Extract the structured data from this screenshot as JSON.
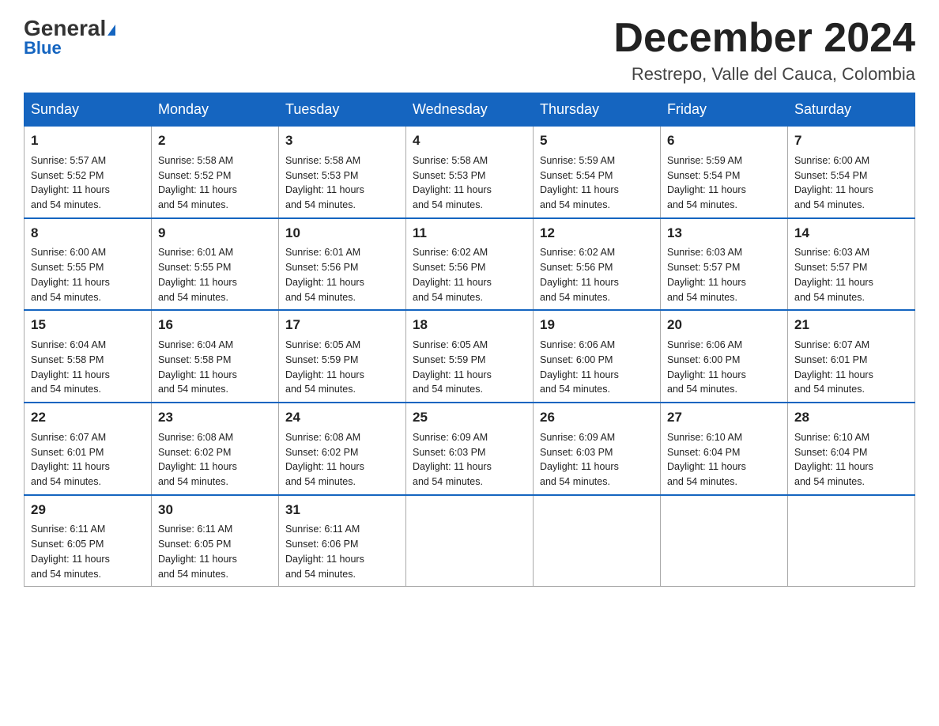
{
  "logo": {
    "line1": "General",
    "triangle": true,
    "line2": "Blue"
  },
  "header": {
    "month": "December 2024",
    "location": "Restrepo, Valle del Cauca, Colombia"
  },
  "days_of_week": [
    "Sunday",
    "Monday",
    "Tuesday",
    "Wednesday",
    "Thursday",
    "Friday",
    "Saturday"
  ],
  "weeks": [
    [
      {
        "day": "1",
        "sunrise": "5:57 AM",
        "sunset": "5:52 PM",
        "daylight": "11 hours and 54 minutes."
      },
      {
        "day": "2",
        "sunrise": "5:58 AM",
        "sunset": "5:52 PM",
        "daylight": "11 hours and 54 minutes."
      },
      {
        "day": "3",
        "sunrise": "5:58 AM",
        "sunset": "5:53 PM",
        "daylight": "11 hours and 54 minutes."
      },
      {
        "day": "4",
        "sunrise": "5:58 AM",
        "sunset": "5:53 PM",
        "daylight": "11 hours and 54 minutes."
      },
      {
        "day": "5",
        "sunrise": "5:59 AM",
        "sunset": "5:54 PM",
        "daylight": "11 hours and 54 minutes."
      },
      {
        "day": "6",
        "sunrise": "5:59 AM",
        "sunset": "5:54 PM",
        "daylight": "11 hours and 54 minutes."
      },
      {
        "day": "7",
        "sunrise": "6:00 AM",
        "sunset": "5:54 PM",
        "daylight": "11 hours and 54 minutes."
      }
    ],
    [
      {
        "day": "8",
        "sunrise": "6:00 AM",
        "sunset": "5:55 PM",
        "daylight": "11 hours and 54 minutes."
      },
      {
        "day": "9",
        "sunrise": "6:01 AM",
        "sunset": "5:55 PM",
        "daylight": "11 hours and 54 minutes."
      },
      {
        "day": "10",
        "sunrise": "6:01 AM",
        "sunset": "5:56 PM",
        "daylight": "11 hours and 54 minutes."
      },
      {
        "day": "11",
        "sunrise": "6:02 AM",
        "sunset": "5:56 PM",
        "daylight": "11 hours and 54 minutes."
      },
      {
        "day": "12",
        "sunrise": "6:02 AM",
        "sunset": "5:56 PM",
        "daylight": "11 hours and 54 minutes."
      },
      {
        "day": "13",
        "sunrise": "6:03 AM",
        "sunset": "5:57 PM",
        "daylight": "11 hours and 54 minutes."
      },
      {
        "day": "14",
        "sunrise": "6:03 AM",
        "sunset": "5:57 PM",
        "daylight": "11 hours and 54 minutes."
      }
    ],
    [
      {
        "day": "15",
        "sunrise": "6:04 AM",
        "sunset": "5:58 PM",
        "daylight": "11 hours and 54 minutes."
      },
      {
        "day": "16",
        "sunrise": "6:04 AM",
        "sunset": "5:58 PM",
        "daylight": "11 hours and 54 minutes."
      },
      {
        "day": "17",
        "sunrise": "6:05 AM",
        "sunset": "5:59 PM",
        "daylight": "11 hours and 54 minutes."
      },
      {
        "day": "18",
        "sunrise": "6:05 AM",
        "sunset": "5:59 PM",
        "daylight": "11 hours and 54 minutes."
      },
      {
        "day": "19",
        "sunrise": "6:06 AM",
        "sunset": "6:00 PM",
        "daylight": "11 hours and 54 minutes."
      },
      {
        "day": "20",
        "sunrise": "6:06 AM",
        "sunset": "6:00 PM",
        "daylight": "11 hours and 54 minutes."
      },
      {
        "day": "21",
        "sunrise": "6:07 AM",
        "sunset": "6:01 PM",
        "daylight": "11 hours and 54 minutes."
      }
    ],
    [
      {
        "day": "22",
        "sunrise": "6:07 AM",
        "sunset": "6:01 PM",
        "daylight": "11 hours and 54 minutes."
      },
      {
        "day": "23",
        "sunrise": "6:08 AM",
        "sunset": "6:02 PM",
        "daylight": "11 hours and 54 minutes."
      },
      {
        "day": "24",
        "sunrise": "6:08 AM",
        "sunset": "6:02 PM",
        "daylight": "11 hours and 54 minutes."
      },
      {
        "day": "25",
        "sunrise": "6:09 AM",
        "sunset": "6:03 PM",
        "daylight": "11 hours and 54 minutes."
      },
      {
        "day": "26",
        "sunrise": "6:09 AM",
        "sunset": "6:03 PM",
        "daylight": "11 hours and 54 minutes."
      },
      {
        "day": "27",
        "sunrise": "6:10 AM",
        "sunset": "6:04 PM",
        "daylight": "11 hours and 54 minutes."
      },
      {
        "day": "28",
        "sunrise": "6:10 AM",
        "sunset": "6:04 PM",
        "daylight": "11 hours and 54 minutes."
      }
    ],
    [
      {
        "day": "29",
        "sunrise": "6:11 AM",
        "sunset": "6:05 PM",
        "daylight": "11 hours and 54 minutes."
      },
      {
        "day": "30",
        "sunrise": "6:11 AM",
        "sunset": "6:05 PM",
        "daylight": "11 hours and 54 minutes."
      },
      {
        "day": "31",
        "sunrise": "6:11 AM",
        "sunset": "6:06 PM",
        "daylight": "11 hours and 54 minutes."
      },
      null,
      null,
      null,
      null
    ]
  ]
}
